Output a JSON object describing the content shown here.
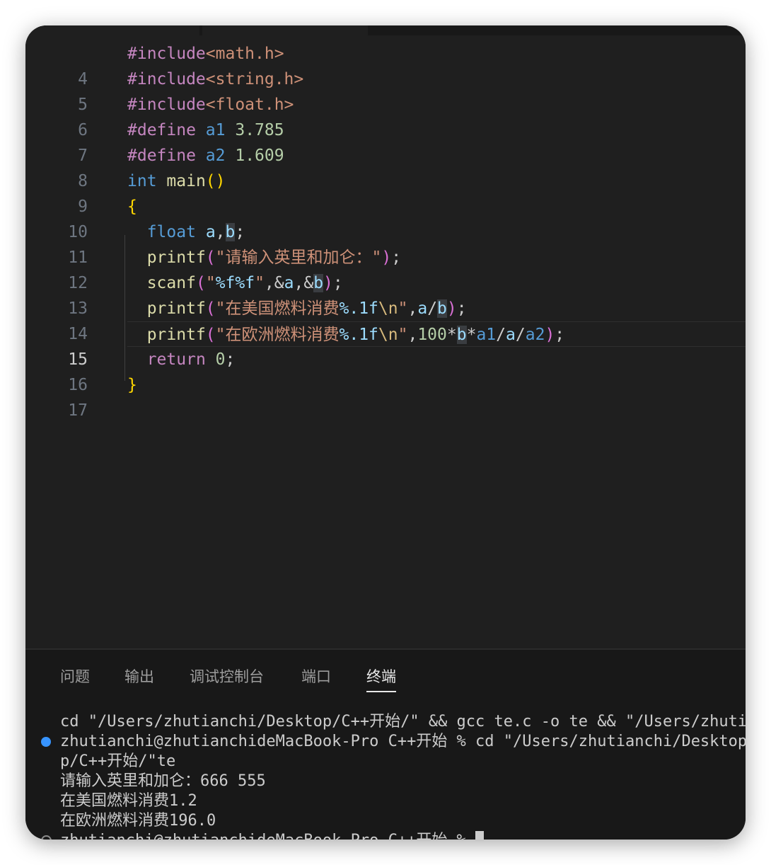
{
  "editor": {
    "lines": [
      {
        "n": "4"
      },
      {
        "n": "5"
      },
      {
        "n": "6"
      },
      {
        "n": "7"
      },
      {
        "n": "8"
      },
      {
        "n": "9"
      },
      {
        "n": "10"
      },
      {
        "n": "11"
      },
      {
        "n": "12"
      },
      {
        "n": "13"
      },
      {
        "n": "14"
      },
      {
        "n": "15"
      },
      {
        "n": "16"
      },
      {
        "n": "17"
      }
    ],
    "current_line": "15"
  },
  "panel": {
    "tabs": [
      "问题",
      "输出",
      "调试控制台",
      "端口",
      "终端"
    ],
    "active_tab": "终端"
  },
  "terminal": {
    "lines": [
      "cd \"/Users/zhutianchi/Desktop/C++开始/\" && gcc te.c -o te && \"/Users/zhutianchi/Desktop/C++开始/\"te",
      "zhutianchi@zhutianchideMacBook-Pro C++开始 % cd \"/Users/zhutianchi/Desktop/C++开始/\" && gcc te.c -o te && \"/Users/zhutianchi/Deskto",
      "p/C++开始/\"te",
      "请输入英里和加仑：666 555",
      "在美国燃料消费1.2",
      "在欧洲燃料消费196.0",
      "zhutianchi@zhutianchideMacBook-Pro C++开始 % "
    ]
  },
  "colors": {
    "editor_bg": "#1f1f1f",
    "panel_bg": "#181818",
    "status_dot": "#3794ff"
  }
}
